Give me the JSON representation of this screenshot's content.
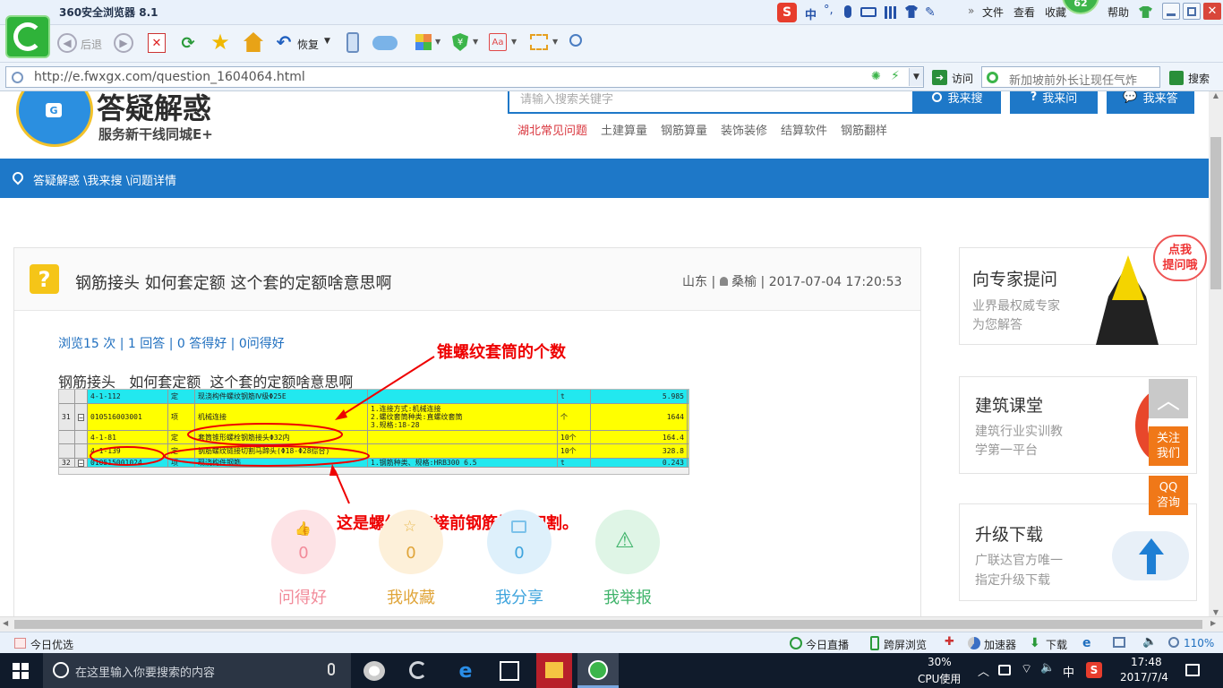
{
  "browser": {
    "app_title": "360安全浏览器 8.1",
    "menu": [
      "文件",
      "查看",
      "收藏",
      "帮助"
    ],
    "badge_count": "62",
    "ime_label": "中",
    "nav": {
      "back": "后退",
      "restore": "恢复"
    },
    "url": "http://e.fwxgx.com/question_1604064.html",
    "visit_label": "访问",
    "search_placeholder": "新加坡前外长让现任气炸",
    "search_button": "搜索"
  },
  "site": {
    "logo_title": "答疑解惑",
    "logo_sub": "服务新干线同城E+",
    "search_placeholder": "请输入搜索关键字",
    "buttons": [
      "我来搜",
      "我来问",
      "我来答"
    ],
    "sub_links": [
      "湖北常见问题",
      "土建算量",
      "钢筋算量",
      "装饰装修",
      "结算软件",
      "钢筋翻样"
    ],
    "breadcrumb": "答疑解惑 \\我来搜 \\问题详情"
  },
  "question": {
    "title": "钢筋接头 如何套定额 这个套的定额啥意思啊",
    "location": "山东",
    "user": "桑榆",
    "datetime": "2017-07-04 17:20:53",
    "stats": "浏览15 次 | 1 回答 | 0 答得好 | 0问得好",
    "body": "钢筋接头   如何套定额  这个套的定额啥意思啊",
    "annotation_1": "锥螺纹套筒的个数",
    "annotation_2": "这是螺纹锥连接前钢筋端头切割。",
    "table": [
      {
        "idx": "",
        "minus": false,
        "code": "4-1-112",
        "type": "定",
        "name": "现浇构件螺纹钢筋Ⅳ级Φ25E",
        "feature": "",
        "unit": "t",
        "qty": "5.985",
        "bg": "#22e8ef"
      },
      {
        "idx": "31",
        "minus": true,
        "code": "010516003001",
        "type": "项",
        "name": "机械连接",
        "feature": "1.连接方式:机械连接\n2.螺纹套筒种类:直螺纹套筒\n3.规格:18-28",
        "unit": "个",
        "qty": "1644",
        "bg": "#ffff00"
      },
      {
        "idx": "",
        "minus": false,
        "code": "4-1-81",
        "type": "定",
        "name": "套筒锥形螺栓钢筋接头Φ32内",
        "feature": "",
        "unit": "10个",
        "qty": "164.4",
        "bg": "#ffff00"
      },
      {
        "idx": "",
        "minus": false,
        "code": "4-1-139",
        "type": "定",
        "name": "钢筋螺纹链接切割马蹄头(Φ18-Φ28综合)",
        "feature": "",
        "unit": "10个",
        "qty": "328.8",
        "bg": "#ffff00"
      },
      {
        "idx": "32",
        "minus": true,
        "code": "010515001024",
        "type": "项",
        "name": "现浇构件钢筋",
        "feature": "1.钢筋种类、规格:HRB300 6.5",
        "unit": "t",
        "qty": "0.243",
        "bg": "#22e8ef"
      }
    ],
    "actions": [
      {
        "count": "0",
        "label": "问得好",
        "color": "#f28b9a",
        "bg": "#fde3e6"
      },
      {
        "count": "0",
        "label": "我收藏",
        "color": "#e0a53a",
        "bg": "#fdf0d9"
      },
      {
        "count": "0",
        "label": "我分享",
        "color": "#3ea4dd",
        "bg": "#def0fb"
      },
      {
        "count": "",
        "label": "我举报",
        "color": "#3fb36a",
        "bg": "#dff5e6"
      }
    ]
  },
  "sidebar": [
    {
      "title": "向专家提问",
      "desc1": "业界最权威专家",
      "desc2": "为您解答",
      "bubble": "点我\n提问哦"
    },
    {
      "title": "建筑课堂",
      "desc1": "建筑行业实训教",
      "desc2": "学第一平台"
    },
    {
      "title": "升级下载",
      "desc1": "广联达官方唯一",
      "desc2": "指定升级下载"
    }
  ],
  "float_buttons": [
    "关注\n我们",
    "QQ\n咨询"
  ],
  "statusbar": {
    "left": "今日优选",
    "items": [
      "今日直播",
      "跨屏浏览",
      "加速器",
      "下载"
    ],
    "zoom": "110%"
  },
  "taskbar": {
    "search_placeholder": "在这里输入你要搜索的内容",
    "cpu_percent": "30%",
    "cpu_label": "CPU使用",
    "ime": "中",
    "time": "17:48",
    "date": "2017/7/4"
  }
}
